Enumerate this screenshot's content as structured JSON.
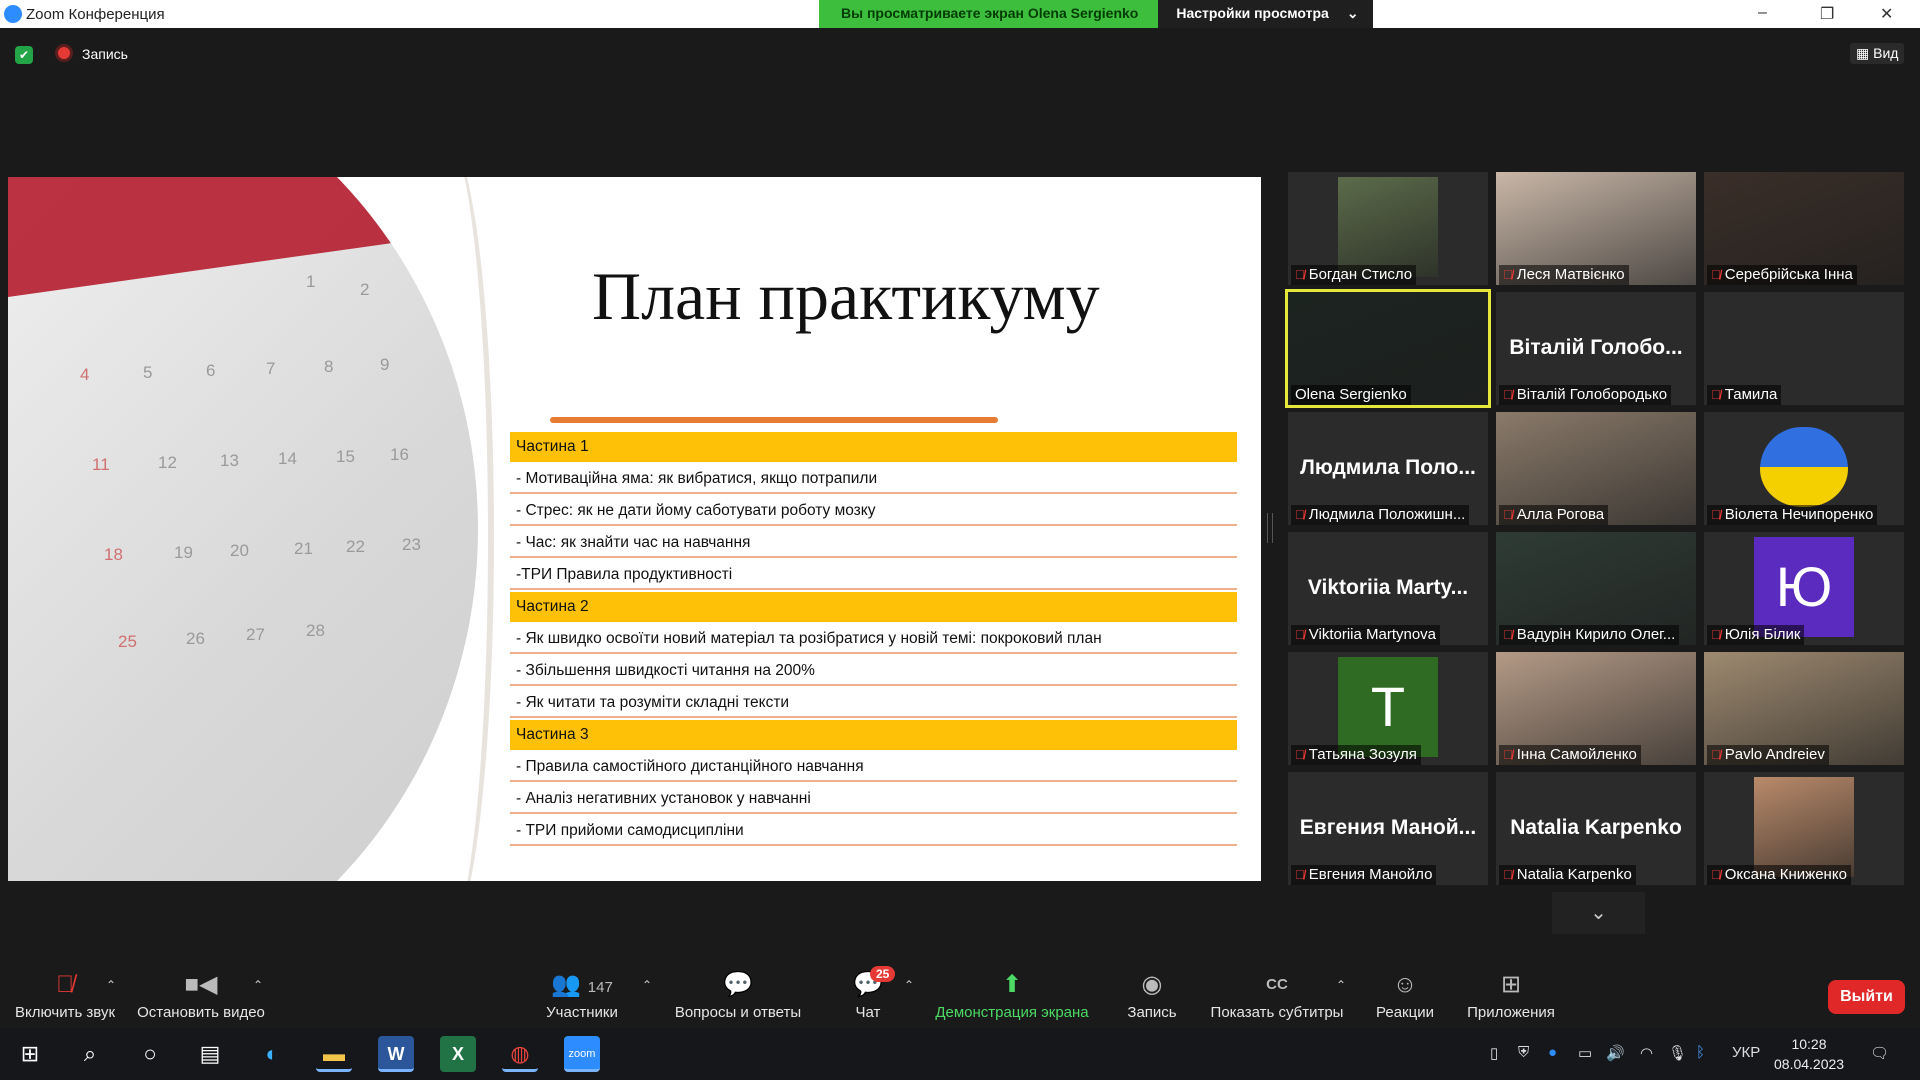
{
  "window": {
    "title": "Zoom Конференция",
    "share_banner": "Вы просматриваете экран Olena Sergienko",
    "view_options": "Настройки просмотра",
    "controls": [
      "–",
      "❐",
      "✕"
    ]
  },
  "meeting_bar": {
    "record_label": "Запись",
    "view_label": "Вид"
  },
  "slide": {
    "title": "План практикуму",
    "rows": [
      {
        "text": "Частина 1",
        "header": true
      },
      {
        "text": "- Мотиваційна яма: як вибратися, якщо потрапили",
        "header": false
      },
      {
        "text": "- Стрес: як не дати йому саботувати роботу мозку",
        "header": false
      },
      {
        "text": "- Час: як знайти час на навчання",
        "header": false
      },
      {
        "text": "-ТРИ Правила продуктивності",
        "header": false
      },
      {
        "text": "Частина 2",
        "header": true
      },
      {
        "text": "- Як швидко освоїти новий матеріал та розібратися у новій темі: покроковий план",
        "header": false
      },
      {
        "text": "- Збільшення швидкості читання на 200%",
        "header": false
      },
      {
        "text": "- Як читати та розуміти складні тексти",
        "header": false
      },
      {
        "text": "Частина 3",
        "header": true
      },
      {
        "text": "- Правила самостійного дистанційного навчання",
        "header": false
      },
      {
        "text": "- Аналіз негативних установок у навчанні",
        "header": false
      },
      {
        "text": "- ТРИ прийоми самодисципліни",
        "header": false
      }
    ],
    "calendar_numbers": [
      "1",
      "2",
      "4",
      "5",
      "6",
      "7",
      "8",
      "9",
      "11",
      "12",
      "13",
      "14",
      "15",
      "16",
      "18",
      "19",
      "20",
      "21",
      "22",
      "23",
      "25",
      "26",
      "27",
      "28"
    ]
  },
  "participants": [
    {
      "name": "Богдан Стисло",
      "type": "photo",
      "color": "#5b6b4a",
      "muted": true
    },
    {
      "name": "Леся Матвієнко",
      "type": "full",
      "color": "#c9b7a8",
      "muted": true
    },
    {
      "name": "Серебрійська Інна",
      "type": "full",
      "color": "#3a2e28",
      "muted": true
    },
    {
      "name": "Olena Sergienko",
      "type": "full",
      "color": "#1c2420",
      "muted": false,
      "active": true
    },
    {
      "name": "Віталій Голобородько",
      "big": "Віталій Голобо...",
      "type": "text",
      "muted": true
    },
    {
      "name": "Тамила",
      "type": "none",
      "muted": true
    },
    {
      "name": "Людмила Положишн...",
      "big": "Людмила Поло...",
      "type": "text",
      "muted": true
    },
    {
      "name": "Алла Рогова",
      "type": "full",
      "color": "#8a7a6a",
      "muted": true
    },
    {
      "name": "Віолета Нечипоренко",
      "type": "heart",
      "muted": true
    },
    {
      "name": "Viktoriia Martynova",
      "big": "Viktoriia Marty...",
      "type": "text",
      "muted": true
    },
    {
      "name": "Вадурін Кирило Олег...",
      "type": "full",
      "color": "#2e3b34",
      "muted": true
    },
    {
      "name": "Юлія Білик",
      "type": "letter",
      "letter": "Ю",
      "color": "#5b2bbf",
      "muted": true
    },
    {
      "name": "Татьяна Зозуля",
      "type": "letter",
      "letter": "T",
      "color": "#2f6b22",
      "muted": true
    },
    {
      "name": "Інна Самойленко",
      "type": "full",
      "color": "#b49a86",
      "muted": true
    },
    {
      "name": "Pavlo Andreiev",
      "type": "full",
      "color": "#9e8a70",
      "muted": true
    },
    {
      "name": "Евгения Манойло",
      "big": "Евгения Маной...",
      "type": "text",
      "muted": true
    },
    {
      "name": "Natalia Karpenko",
      "big": "Natalia Karpenko",
      "type": "text",
      "muted": true
    },
    {
      "name": "Оксана Книженко",
      "type": "photo",
      "color": "#b98a6a",
      "muted": true
    }
  ],
  "toolbar": {
    "unmute": "Включить звук",
    "stop_video": "Остановить видео",
    "participants": "Участники",
    "participants_count": "147",
    "qa": "Вопросы и ответы",
    "chat": "Чат",
    "chat_badge": "25",
    "share": "Демонстрация экрана",
    "record": "Запись",
    "captions": "Показать субтитры",
    "reactions": "Реакции",
    "apps": "Приложения",
    "leave": "Выйти"
  },
  "taskbar": {
    "lang": "УКР",
    "time": "10:28",
    "date": "08.04.2023"
  },
  "colors": {
    "accent_yellow": "#ffc107",
    "share_green": "#3dbf3d",
    "leave_red": "#e02828"
  }
}
